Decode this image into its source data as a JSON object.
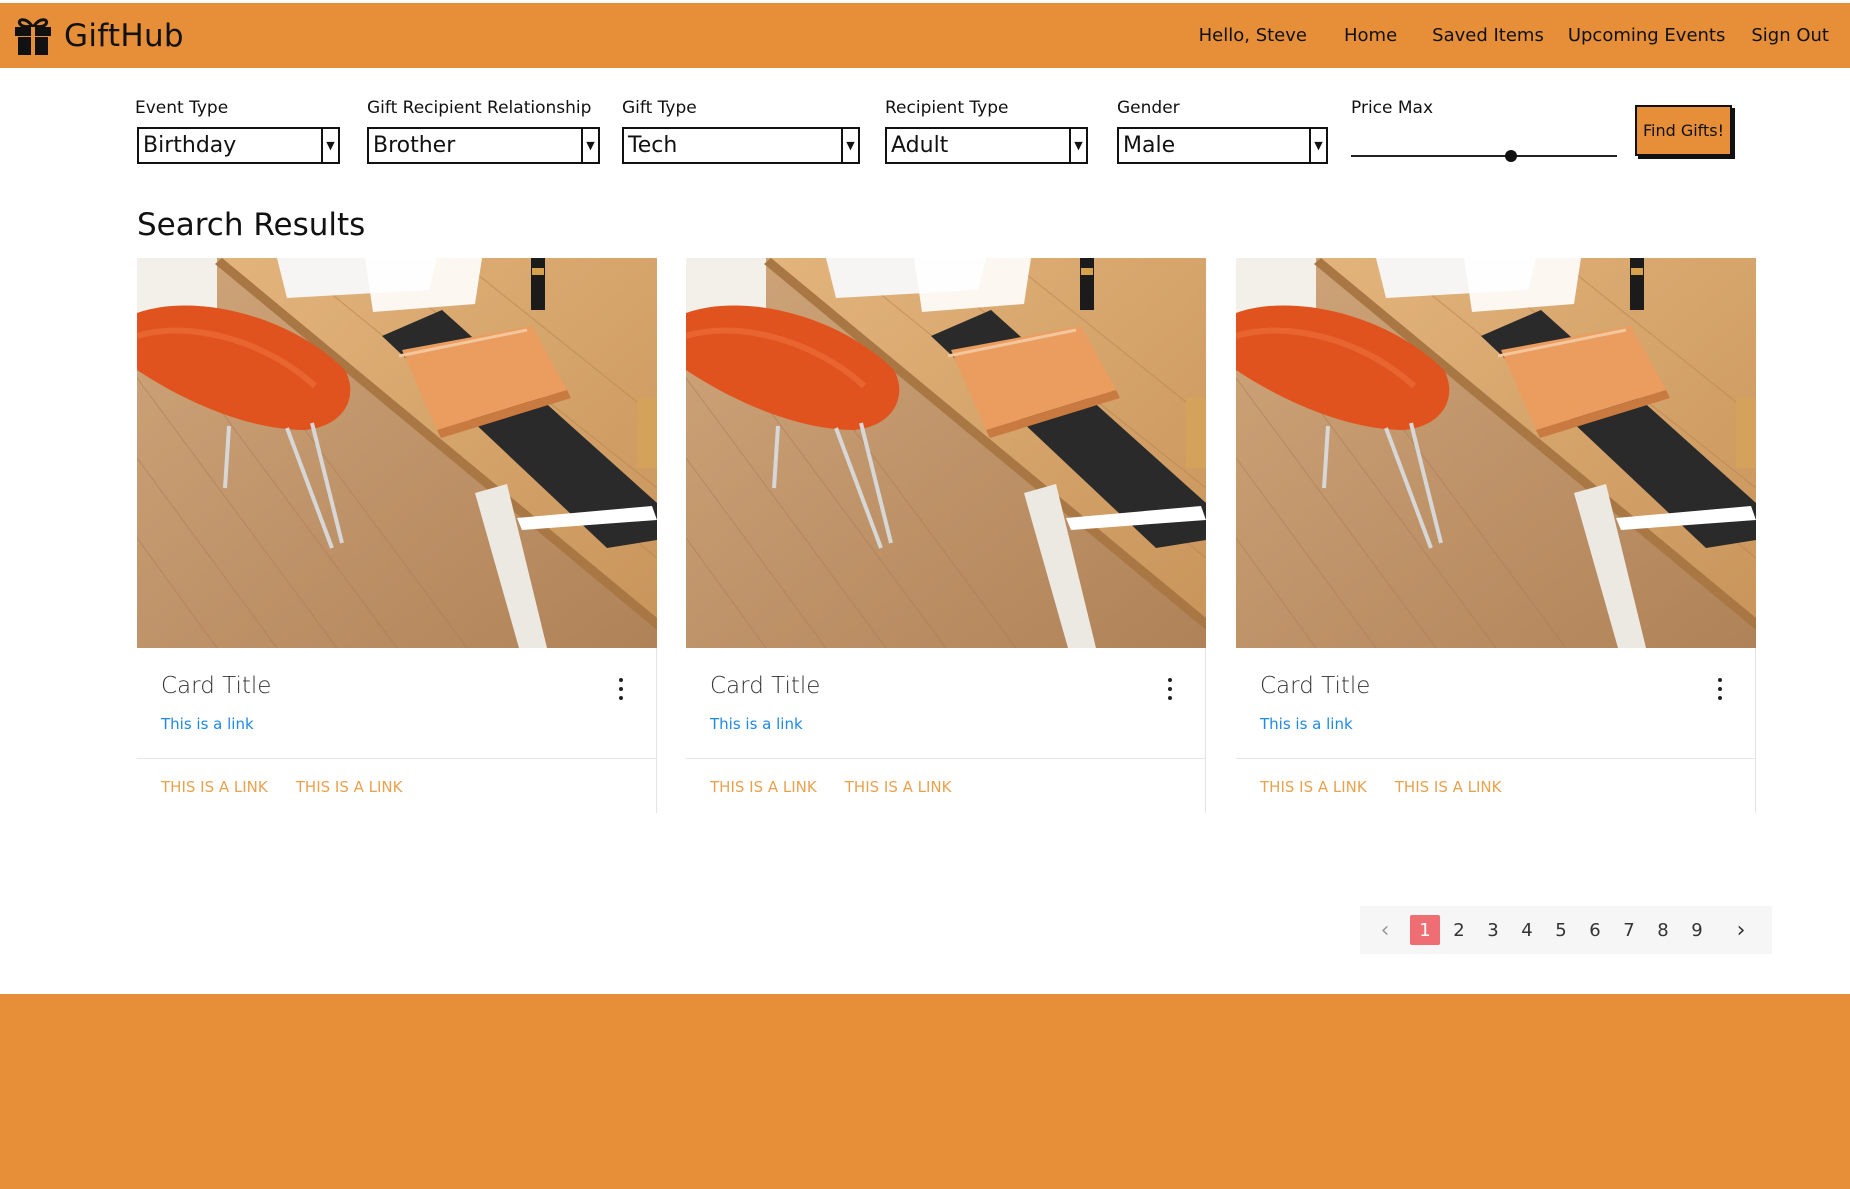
{
  "brand": {
    "name": "GiftHub",
    "icon": "gift-icon"
  },
  "nav": {
    "greeting": "Hello, Steve",
    "home": "Home",
    "saved": "Saved Items",
    "events": "Upcoming Events",
    "signout": "Sign Out"
  },
  "filters": {
    "event_type": {
      "label": "Event Type",
      "value": "Birthday"
    },
    "relationship": {
      "label": "Gift Recipient Relationship",
      "value": "Brother"
    },
    "gift_type": {
      "label": "Gift Type",
      "value": "Tech"
    },
    "recipient_type": {
      "label": "Recipient Type",
      "value": "Adult"
    },
    "gender": {
      "label": "Gender",
      "value": "Male"
    },
    "price_max": {
      "label": "Price Max",
      "level": 0.6
    },
    "find_button": "Find Gifts!"
  },
  "results": {
    "title": "Search Results",
    "cards": [
      {
        "title": "Card Title",
        "link": "This is a link",
        "actions": [
          "THIS IS A LINK",
          "THIS IS A LINK"
        ]
      },
      {
        "title": "Card Title",
        "link": "This is a link",
        "actions": [
          "THIS IS A LINK",
          "THIS IS A LINK"
        ]
      },
      {
        "title": "Card Title",
        "link": "This is a link",
        "actions": [
          "THIS IS A LINK",
          "THIS IS A LINK"
        ]
      }
    ]
  },
  "pagination": {
    "pages": [
      "1",
      "2",
      "3",
      "4",
      "5",
      "6",
      "7",
      "8",
      "9"
    ],
    "current": "1",
    "prev_icon": "chevron-left-icon",
    "next_icon": "chevron-right-icon"
  },
  "colors": {
    "brand_orange": "#e68f38",
    "link_blue": "#1e88e5",
    "action_orange": "#e8a24e",
    "active_page": "#ee6e73"
  }
}
